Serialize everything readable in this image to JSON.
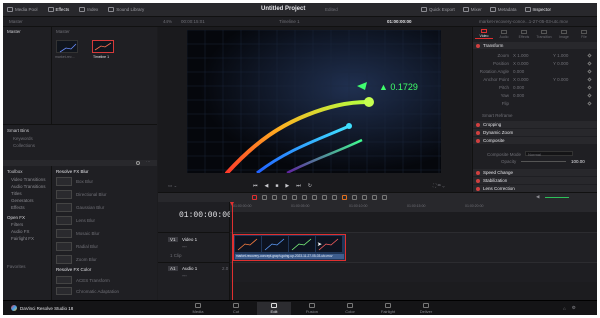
{
  "top_tabs": [
    {
      "label": "Media Pool",
      "icon": "media-pool-icon"
    },
    {
      "label": "Effects",
      "icon": "effects-icon"
    },
    {
      "label": "Index",
      "icon": "index-icon"
    },
    {
      "label": "Sound Library",
      "icon": "sound-library-icon"
    }
  ],
  "title": "Untitled Project",
  "title_status": "Edited",
  "right_tabs": [
    {
      "label": "Quick Export",
      "icon": "export-icon"
    },
    {
      "label": "Mixer",
      "icon": "mixer-icon"
    },
    {
      "label": "Metadata",
      "icon": "metadata-icon"
    },
    {
      "label": "Inspector",
      "icon": "inspector-icon"
    }
  ],
  "viewer": {
    "zoom": "44%",
    "timecode": "00:00:15:01",
    "timeline_name": "Timeline 1",
    "right_timecode": "01:00:00:00",
    "chart_overlay": "▲ 0.1729"
  },
  "clip_name": "market-recovery-conce...1-27-05-03-utc.mov",
  "media_pool": {
    "bin_label": "Master",
    "column_label": "Master",
    "clips": [
      "market-rec...",
      "Timeline 1"
    ]
  },
  "smart_bins": {
    "title": "Smart Bins",
    "items": [
      "Keywords",
      "Collections"
    ]
  },
  "toolbox": {
    "title": "Toolbox",
    "items": [
      "Video Transitions",
      "Audio Transitions",
      "Titles",
      "Generators",
      "Effects",
      "Open FX",
      "Filters",
      "Audio FX",
      "Fairlight FX"
    ],
    "favorites": "Favorites"
  },
  "fx": {
    "group1": "Resolve FX Blur",
    "items1": [
      "Box Blur",
      "Directional Blur",
      "Gaussian Blur",
      "Lens Blur",
      "Mosaic Blur",
      "Radial Blur",
      "Zoom Blur"
    ],
    "group2": "Resolve FX Color",
    "items2": [
      "ACES Transform",
      "Chromatic Adaptation"
    ]
  },
  "inspector": {
    "tabs": [
      "Video",
      "Audio",
      "Effects",
      "Transition",
      "Image",
      "File"
    ],
    "transform": "Transform",
    "rows": [
      {
        "label": "Zoom",
        "x": "X  1.000",
        "y": "Y  1.000"
      },
      {
        "label": "Position",
        "x": "X  0.000",
        "y": "Y  0.000"
      },
      {
        "label": "Rotation Angle",
        "x": "0.000",
        "y": ""
      },
      {
        "label": "Anchor Point",
        "x": "X  0.000",
        "y": "Y  0.000"
      },
      {
        "label": "Pitch",
        "x": "0.000",
        "y": ""
      },
      {
        "label": "Yaw",
        "x": "0.000",
        "y": ""
      },
      {
        "label": "Flip",
        "x": "",
        "y": ""
      }
    ],
    "smart_reframe": "Smart Reframe",
    "cropping": "Cropping",
    "dynamic_zoom": "Dynamic Zoom",
    "composite": "Composite",
    "composite_mode_label": "Composite Mode",
    "composite_mode": "Normal",
    "opacity_label": "Opacity",
    "opacity": "100.00",
    "speed_change": "Speed Change",
    "stabilization": "Stabilization",
    "lens_correction": "Lens Correction"
  },
  "timeline": {
    "timecode": "01:00:00:00",
    "ruler": [
      "01:00:00:00",
      "01:00:05:00",
      "01:00:10:00",
      "01:00:15:00",
      "01:00:20:00"
    ],
    "video_track": {
      "id": "V1",
      "name": "Video 1",
      "clips": "1 Clip"
    },
    "audio_track": {
      "id": "A1",
      "name": "Audio 1",
      "level": "2.0"
    },
    "clip_label": "market-recovery-concept-graph-going-up-2023-11-27-05-03-utc.mov"
  },
  "pages": [
    {
      "label": "Media",
      "icon": "media-page-icon"
    },
    {
      "label": "Cut",
      "icon": "cut-page-icon"
    },
    {
      "label": "Edit",
      "icon": "edit-page-icon"
    },
    {
      "label": "Fusion",
      "icon": "fusion-page-icon"
    },
    {
      "label": "Color",
      "icon": "color-page-icon"
    },
    {
      "label": "Fairlight",
      "icon": "fairlight-page-icon"
    },
    {
      "label": "Deliver",
      "icon": "deliver-page-icon"
    }
  ],
  "active_page": "Edit",
  "app_name": "DaVinci Resolve Studio 18",
  "colors": {
    "accent_red": "#e03030",
    "playhead": "#e03030",
    "clip_blue": "#2a4a7a",
    "link_orange": "#e07020"
  }
}
